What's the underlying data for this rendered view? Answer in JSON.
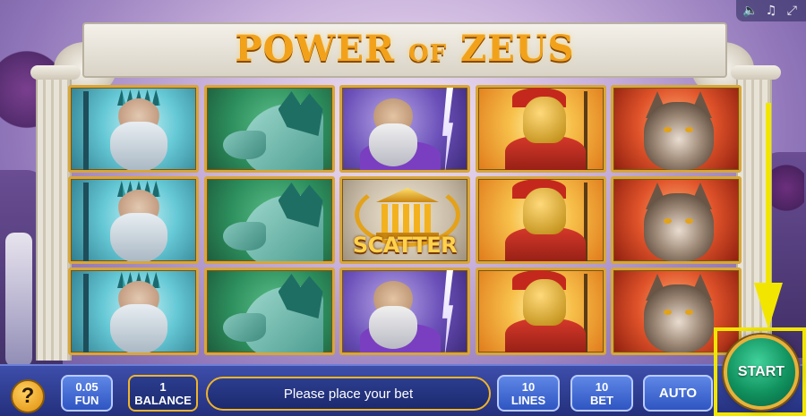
{
  "game": {
    "title_main_1": "POWER",
    "title_small": "OF",
    "title_main_2": "ZEUS"
  },
  "top_controls": {
    "icons": [
      "volume-icon",
      "music-icon",
      "fullscreen-icon"
    ]
  },
  "reels": {
    "columns": [
      [
        "poseidon",
        "poseidon",
        "poseidon"
      ],
      [
        "horse",
        "horse",
        "horse"
      ],
      [
        "zeus",
        "scatter",
        "zeus"
      ],
      [
        "spartan",
        "spartan",
        "spartan"
      ],
      [
        "wolf",
        "wolf",
        "wolf"
      ]
    ],
    "scatter_label": "SCATTER"
  },
  "bottom_bar": {
    "help_label": "?",
    "fun_value": "0.05",
    "fun_label": "FUN",
    "balance_value": "1",
    "balance_label": "BALANCE",
    "message": "Please place your bet",
    "lines_value": "10",
    "lines_label": "LINES",
    "bet_value": "10",
    "bet_label": "BET",
    "auto_label": "AUTO",
    "start_label": "START"
  },
  "colors": {
    "highlight": "#f2e600",
    "accent_gold": "#f0b429",
    "bar_blue": "#2f55c2",
    "start_green": "#10915e"
  }
}
